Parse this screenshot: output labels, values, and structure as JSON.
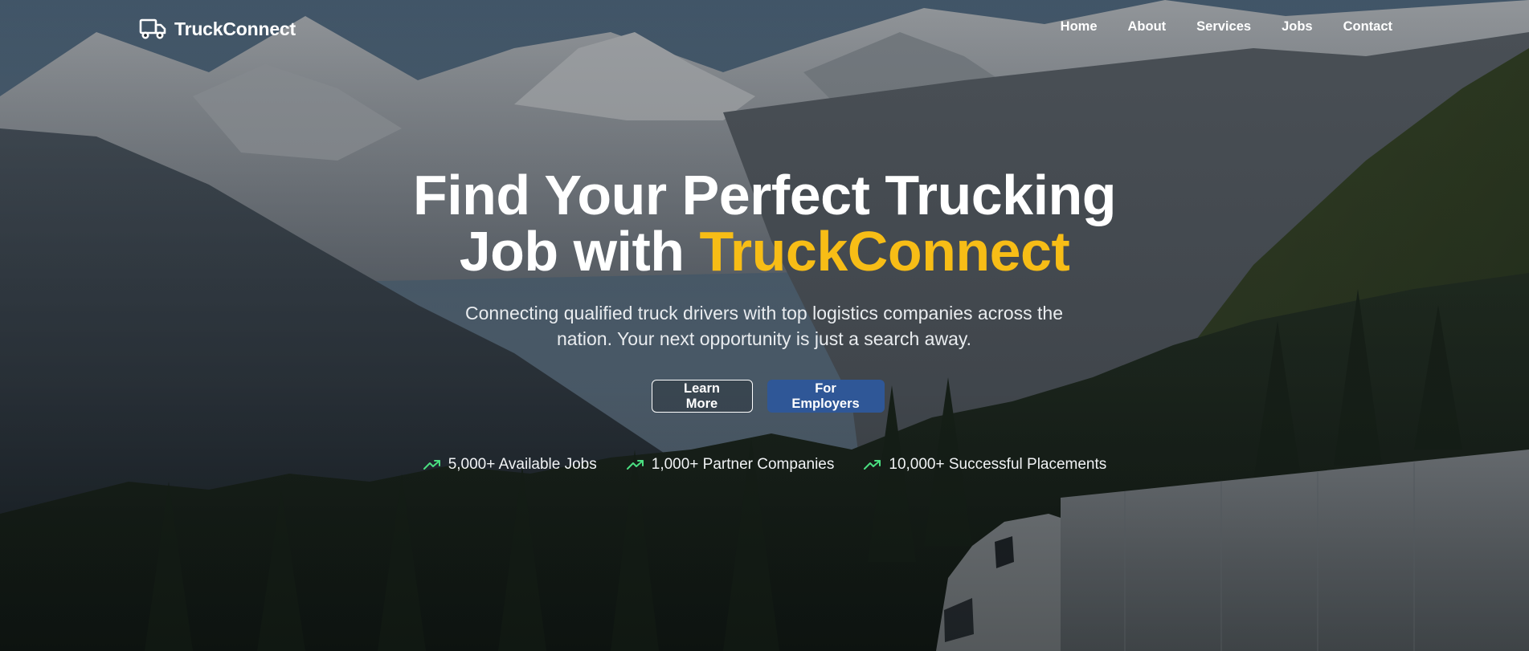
{
  "brand": {
    "name": "TruckConnect",
    "icon": "truck-icon"
  },
  "nav": {
    "items": [
      "Home",
      "About",
      "Services",
      "Jobs",
      "Contact"
    ]
  },
  "hero": {
    "headline_part1": "Find Your Perfect Trucking",
    "headline_part2": "Job with ",
    "headline_accent": "TruckConnect",
    "subtitle": "Connecting qualified truck drivers with top logistics companies across the nation. Your next opportunity is just a search away.",
    "cta_secondary": "Learn More",
    "cta_primary": "For Employers"
  },
  "stats": [
    {
      "icon": "trending-up-icon",
      "label": "5,000+ Available Jobs"
    },
    {
      "icon": "trending-up-icon",
      "label": "1,000+ Partner Companies"
    },
    {
      "icon": "trending-up-icon",
      "label": "10,000+ Successful Placements"
    }
  ],
  "colors": {
    "accent": "#f7bd16",
    "primary_button": "#2f5797",
    "stat_icon": "#4ade80",
    "text": "#ffffff"
  }
}
